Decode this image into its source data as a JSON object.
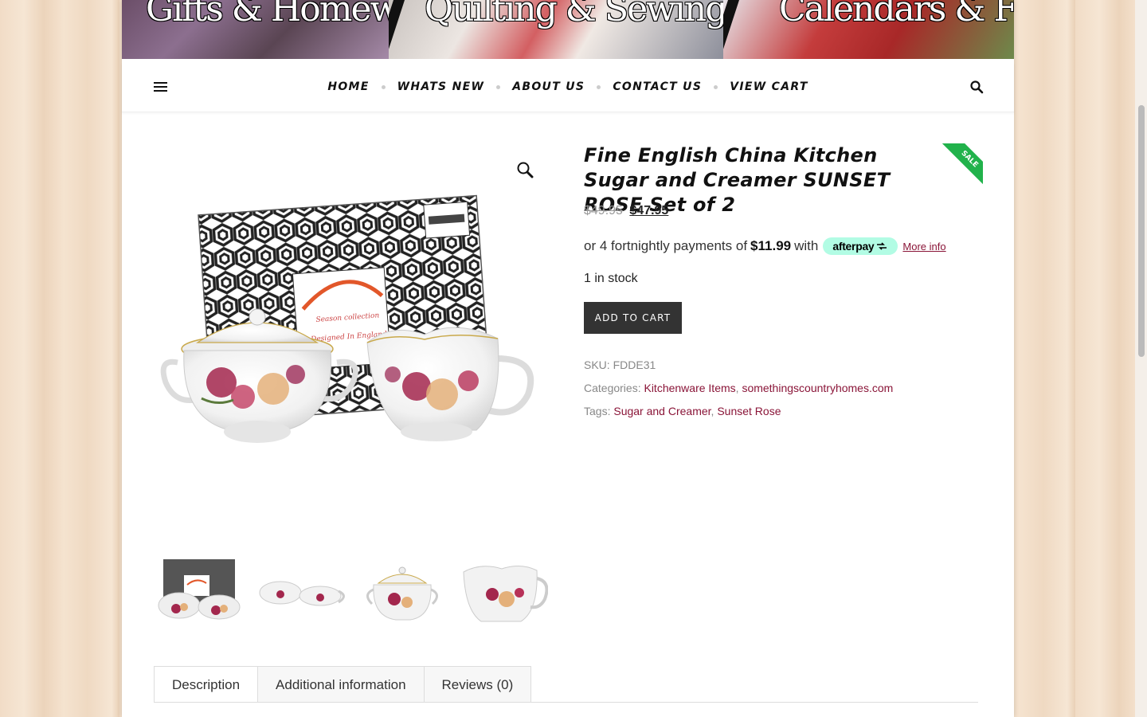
{
  "banner": {
    "segments": [
      "Gifts & Homewares",
      "Quilting & Sewing Supplies",
      "Calendars & Frames"
    ]
  },
  "nav": {
    "items": [
      "HOME",
      "WHATS NEW",
      "ABOUT US",
      "CONTACT US",
      "VIEW CART"
    ]
  },
  "product": {
    "title": "Fine English China Kitchen Sugar and Creamer SUNSET ROSE Set of 2",
    "sale_badge": "SALE",
    "price_old": "$49.95",
    "price_new": "$47.95",
    "afterpay_prefix": "or 4 fortnightly payments of",
    "afterpay_amount": "$11.99",
    "afterpay_with": "with",
    "afterpay_brand": "afterpay",
    "afterpay_more": "More info",
    "stock": "1 in stock",
    "add_to_cart": "ADD TO CART",
    "sku_label": "SKU:",
    "sku": "FDDE31",
    "categories_label": "Categories:",
    "categories": [
      "Kitchenware Items",
      "somethingscountryhomes.com"
    ],
    "tags_label": "Tags:",
    "tags": [
      "Sugar and Creamer",
      "Sunset Rose"
    ],
    "image_box_text": [
      "Season collection",
      "Designed In England"
    ]
  },
  "tabs": [
    "Description",
    "Additional information",
    "Reviews (0)"
  ],
  "colors": {
    "link": "#8a1538",
    "sale": "#21b24b",
    "afterpay": "#b2fce4",
    "button": "#333333"
  }
}
